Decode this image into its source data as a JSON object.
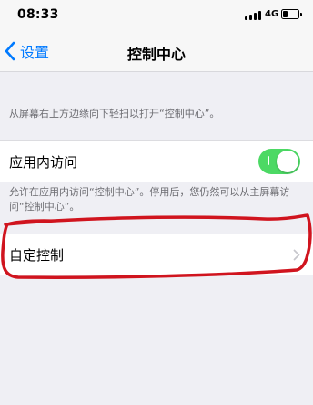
{
  "status_bar": {
    "time": "08:33",
    "network": "4G"
  },
  "nav": {
    "back_label": "设置",
    "title": "控制中心"
  },
  "section_header": "从屏幕右上方边缘向下轻扫以打开“控制中心”。",
  "access_in_apps": {
    "label": "应用内访问",
    "enabled": true,
    "footer": "允许在应用内访问“控制中心”。停用后，您仍然可以从主屏幕访问“控制中心”。"
  },
  "customize": {
    "label": "自定控制"
  },
  "colors": {
    "accent": "#007aff",
    "toggle_on": "#4cd964",
    "annotation": "#d0141e"
  },
  "icons": {
    "back": "chevron-left-icon",
    "row": "chevron-right-icon",
    "signal": "signal-bars-icon",
    "battery": "battery-icon"
  }
}
